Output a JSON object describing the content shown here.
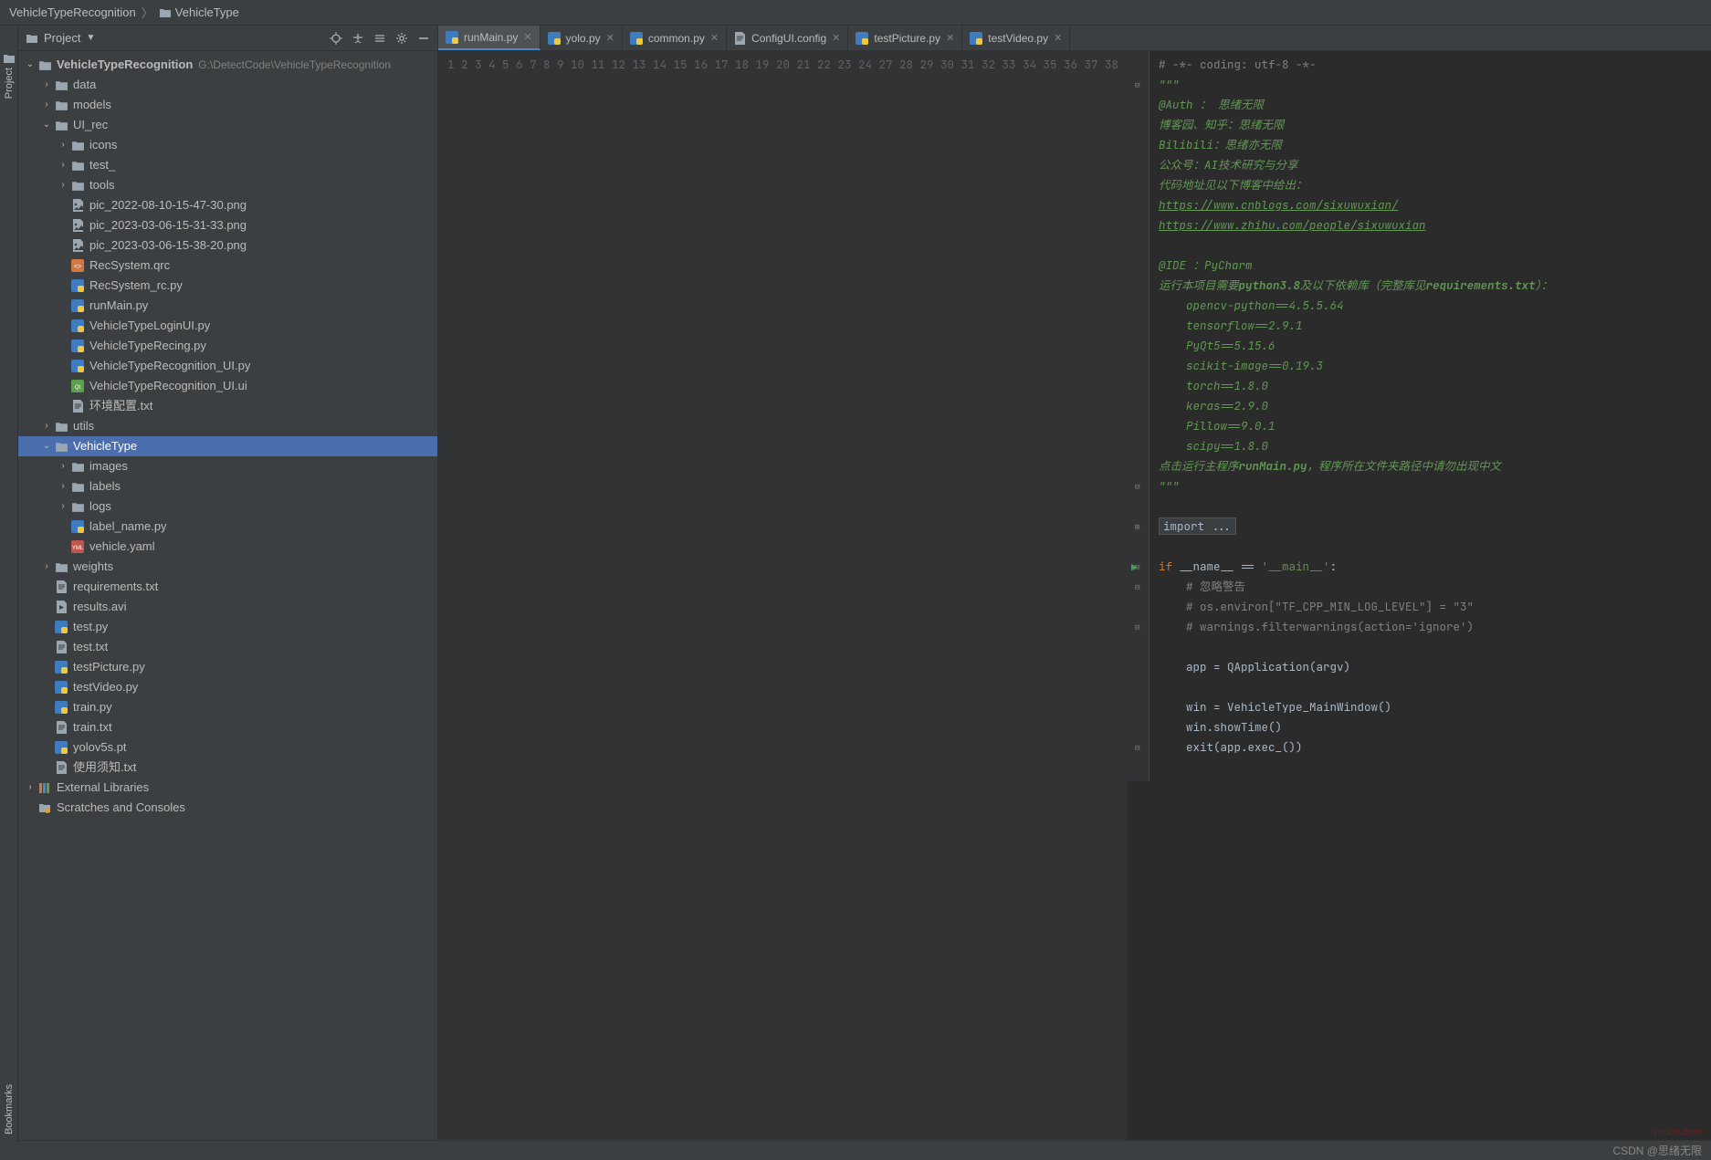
{
  "breadcrumb": {
    "root": "VehicleTypeRecognition",
    "item": "VehicleType"
  },
  "panel": {
    "title": "Project"
  },
  "sidebar": {
    "project_label": "Project",
    "bookmarks_label": "Bookmarks"
  },
  "tree": [
    {
      "depth": 0,
      "arrow": "down",
      "icon": "folder",
      "label": "VehicleTypeRecognition",
      "sub": "G:\\DetectCode\\VehicleTypeRecognition",
      "root": true
    },
    {
      "depth": 1,
      "arrow": "right",
      "icon": "folder",
      "label": "data"
    },
    {
      "depth": 1,
      "arrow": "right",
      "icon": "folder",
      "label": "models"
    },
    {
      "depth": 1,
      "arrow": "down",
      "icon": "folder",
      "label": "UI_rec"
    },
    {
      "depth": 2,
      "arrow": "right",
      "icon": "folder",
      "label": "icons"
    },
    {
      "depth": 2,
      "arrow": "right",
      "icon": "folder",
      "label": "test_"
    },
    {
      "depth": 2,
      "arrow": "right",
      "icon": "folder",
      "label": "tools"
    },
    {
      "depth": 2,
      "arrow": "none",
      "icon": "image",
      "label": "pic_2022-08-10-15-47-30.png"
    },
    {
      "depth": 2,
      "arrow": "none",
      "icon": "image",
      "label": "pic_2023-03-06-15-31-33.png"
    },
    {
      "depth": 2,
      "arrow": "none",
      "icon": "image",
      "label": "pic_2023-03-06-15-38-20.png"
    },
    {
      "depth": 2,
      "arrow": "none",
      "icon": "qrc",
      "label": "RecSystem.qrc"
    },
    {
      "depth": 2,
      "arrow": "none",
      "icon": "py",
      "label": "RecSystem_rc.py"
    },
    {
      "depth": 2,
      "arrow": "none",
      "icon": "py",
      "label": "runMain.py"
    },
    {
      "depth": 2,
      "arrow": "none",
      "icon": "py",
      "label": "VehicleTypeLoginUI.py"
    },
    {
      "depth": 2,
      "arrow": "none",
      "icon": "py",
      "label": "VehicleTypeRecing.py"
    },
    {
      "depth": 2,
      "arrow": "none",
      "icon": "py",
      "label": "VehicleTypeRecognition_UI.py"
    },
    {
      "depth": 2,
      "arrow": "none",
      "icon": "ui",
      "label": "VehicleTypeRecognition_UI.ui"
    },
    {
      "depth": 2,
      "arrow": "none",
      "icon": "txt",
      "label": "环境配置.txt"
    },
    {
      "depth": 1,
      "arrow": "right",
      "icon": "folder",
      "label": "utils"
    },
    {
      "depth": 1,
      "arrow": "down",
      "icon": "folder",
      "label": "VehicleType",
      "selected": true
    },
    {
      "depth": 2,
      "arrow": "right",
      "icon": "folder",
      "label": "images"
    },
    {
      "depth": 2,
      "arrow": "right",
      "icon": "folder",
      "label": "labels"
    },
    {
      "depth": 2,
      "arrow": "right",
      "icon": "folder",
      "label": "logs"
    },
    {
      "depth": 2,
      "arrow": "none",
      "icon": "py",
      "label": "label_name.py"
    },
    {
      "depth": 2,
      "arrow": "none",
      "icon": "yaml",
      "label": "vehicle.yaml"
    },
    {
      "depth": 1,
      "arrow": "right",
      "icon": "folder",
      "label": "weights"
    },
    {
      "depth": 1,
      "arrow": "none",
      "icon": "txt",
      "label": "requirements.txt"
    },
    {
      "depth": 1,
      "arrow": "none",
      "icon": "video",
      "label": "results.avi"
    },
    {
      "depth": 1,
      "arrow": "none",
      "icon": "py",
      "label": "test.py"
    },
    {
      "depth": 1,
      "arrow": "none",
      "icon": "txt",
      "label": "test.txt"
    },
    {
      "depth": 1,
      "arrow": "none",
      "icon": "py",
      "label": "testPicture.py"
    },
    {
      "depth": 1,
      "arrow": "none",
      "icon": "py",
      "label": "testVideo.py"
    },
    {
      "depth": 1,
      "arrow": "none",
      "icon": "py",
      "label": "train.py"
    },
    {
      "depth": 1,
      "arrow": "none",
      "icon": "txt",
      "label": "train.txt"
    },
    {
      "depth": 1,
      "arrow": "none",
      "icon": "py",
      "label": "yolov5s.pt"
    },
    {
      "depth": 1,
      "arrow": "none",
      "icon": "txt",
      "label": "使用须知.txt"
    },
    {
      "depth": 0,
      "arrow": "right",
      "icon": "lib",
      "label": "External Libraries"
    },
    {
      "depth": 0,
      "arrow": "none",
      "icon": "scratch",
      "label": "Scratches and Consoles"
    }
  ],
  "tabs": [
    {
      "icon": "py",
      "label": "runMain.py",
      "active": true,
      "closable": true
    },
    {
      "icon": "py",
      "label": "yolo.py",
      "active": false,
      "closable": true
    },
    {
      "icon": "py",
      "label": "common.py",
      "active": false,
      "closable": true
    },
    {
      "icon": "cfg",
      "label": "ConfigUI.config",
      "active": false,
      "closable": true
    },
    {
      "icon": "py",
      "label": "testPicture.py",
      "active": false,
      "closable": true
    },
    {
      "icon": "py",
      "label": "testVideo.py",
      "active": false,
      "closable": true
    }
  ],
  "code": {
    "run_line": 28,
    "lines": [
      {
        "n": 1,
        "segs": [
          {
            "cls": "c-comment",
            "t": "# -*- coding: utf-8 -*-"
          }
        ]
      },
      {
        "n": 2,
        "segs": [
          {
            "cls": "c-docstr",
            "t": "\"\"\""
          }
        ],
        "fold": "-"
      },
      {
        "n": 3,
        "segs": [
          {
            "cls": "c-docstr",
            "t": "@Auth ： 思绪无限"
          }
        ]
      },
      {
        "n": 4,
        "segs": [
          {
            "cls": "c-docstr",
            "t": "博客园、知乎：思绪无限"
          }
        ]
      },
      {
        "n": 5,
        "segs": [
          {
            "cls": "c-docstr",
            "t": "Bilibili：思绪亦无限"
          }
        ]
      },
      {
        "n": 6,
        "segs": [
          {
            "cls": "c-docstr",
            "t": "公众号：AI技术研究与分享"
          }
        ]
      },
      {
        "n": 7,
        "segs": [
          {
            "cls": "c-docstr",
            "t": "代码地址见以下博客中给出："
          }
        ]
      },
      {
        "n": 8,
        "segs": [
          {
            "cls": "c-link",
            "t": "https://www.cnblogs.com/sixuwuxian/"
          }
        ]
      },
      {
        "n": 9,
        "segs": [
          {
            "cls": "c-link",
            "t": "https://www.zhihu.com/people/sixuwuxian"
          }
        ]
      },
      {
        "n": 10,
        "segs": [
          {
            "cls": "",
            "t": ""
          }
        ]
      },
      {
        "n": 11,
        "segs": [
          {
            "cls": "c-docstr",
            "t": "@IDE ：PyCharm"
          }
        ]
      },
      {
        "n": 12,
        "segs": [
          {
            "cls": "c-docstr",
            "t": "运行本项目需要"
          },
          {
            "cls": "c-docstr c-bold",
            "t": "python3.8"
          },
          {
            "cls": "c-docstr",
            "t": "及以下依赖库（完整库见"
          },
          {
            "cls": "c-docstr c-bold",
            "t": "requirements.txt"
          },
          {
            "cls": "c-docstr",
            "t": "）："
          }
        ]
      },
      {
        "n": 13,
        "segs": [
          {
            "cls": "c-docstr",
            "t": "    opencv-python==4.5.5.64"
          }
        ]
      },
      {
        "n": 14,
        "segs": [
          {
            "cls": "c-docstr",
            "t": "    tensorflow==2.9.1"
          }
        ]
      },
      {
        "n": 15,
        "segs": [
          {
            "cls": "c-docstr",
            "t": "    PyQt5==5.15.6"
          }
        ]
      },
      {
        "n": 16,
        "segs": [
          {
            "cls": "c-docstr",
            "t": "    scikit-image==0.19.3"
          }
        ]
      },
      {
        "n": 17,
        "segs": [
          {
            "cls": "c-docstr",
            "t": "    torch==1.8.0"
          }
        ]
      },
      {
        "n": 18,
        "segs": [
          {
            "cls": "c-docstr",
            "t": "    keras==2.9.0"
          }
        ]
      },
      {
        "n": 19,
        "segs": [
          {
            "cls": "c-docstr",
            "t": "    Pillow==9.0.1"
          }
        ]
      },
      {
        "n": 20,
        "segs": [
          {
            "cls": "c-docstr",
            "t": "    scipy==1.8.0"
          }
        ]
      },
      {
        "n": 21,
        "segs": [
          {
            "cls": "c-docstr",
            "t": "点击运行主程序"
          },
          {
            "cls": "c-docstr c-bold",
            "t": "runMain.py"
          },
          {
            "cls": "c-docstr",
            "t": "，程序所在文件夹路径中请勿出现中文"
          }
        ]
      },
      {
        "n": 22,
        "segs": [
          {
            "cls": "c-docstr",
            "t": "\"\"\""
          }
        ],
        "fold": "-"
      },
      {
        "n": 23,
        "segs": [
          {
            "cls": "",
            "t": ""
          }
        ]
      },
      {
        "n": 24,
        "segs": [
          {
            "cls": "c-fold",
            "t": "import ..."
          }
        ],
        "fold": "+"
      },
      {
        "n": 27,
        "segs": [
          {
            "cls": "",
            "t": ""
          }
        ]
      },
      {
        "n": 28,
        "segs": [
          {
            "cls": "c-keyword",
            "t": "if "
          },
          {
            "cls": "",
            "t": "__name__ == "
          },
          {
            "cls": "c-string",
            "t": "'__main__'"
          },
          {
            "cls": "",
            "t": ":"
          }
        ],
        "fold": "-"
      },
      {
        "n": 29,
        "segs": [
          {
            "cls": "",
            "t": "    "
          },
          {
            "cls": "c-comment",
            "t": "# 忽略警告"
          }
        ],
        "fold": "-"
      },
      {
        "n": 30,
        "segs": [
          {
            "cls": "",
            "t": "    "
          },
          {
            "cls": "c-comment",
            "t": "# os.environ[\"TF_CPP_MIN_LOG_LEVEL\"] = \"3\""
          }
        ]
      },
      {
        "n": 31,
        "segs": [
          {
            "cls": "",
            "t": "    "
          },
          {
            "cls": "c-comment",
            "t": "# warnings.filterwarnings(action='ignore')"
          }
        ],
        "fold": "-"
      },
      {
        "n": 32,
        "segs": [
          {
            "cls": "",
            "t": ""
          }
        ]
      },
      {
        "n": 33,
        "segs": [
          {
            "cls": "",
            "t": "    app = QApplication(argv)"
          }
        ]
      },
      {
        "n": 34,
        "segs": [
          {
            "cls": "",
            "t": ""
          }
        ]
      },
      {
        "n": 35,
        "segs": [
          {
            "cls": "",
            "t": "    win = VehicleType_MainWindow()"
          }
        ]
      },
      {
        "n": 36,
        "segs": [
          {
            "cls": "",
            "t": "    win.showTime()"
          }
        ]
      },
      {
        "n": 37,
        "segs": [
          {
            "cls": "",
            "t": "    exit(app.exec_())"
          }
        ],
        "fold": "-"
      },
      {
        "n": 38,
        "segs": [
          {
            "cls": "",
            "t": ""
          }
        ]
      }
    ]
  },
  "status": {
    "text": "CSDN @思绪无限"
  },
  "watermark": "Yuucn.com"
}
